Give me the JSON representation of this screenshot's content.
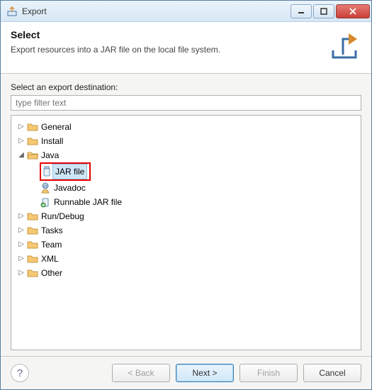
{
  "window": {
    "title": "Export"
  },
  "banner": {
    "title": "Select",
    "description": "Export resources into a JAR file on the local file system."
  },
  "content": {
    "label": "Select an export destination:",
    "filter_placeholder": "type filter text"
  },
  "tree": {
    "general": "General",
    "install": "Install",
    "java": "Java",
    "jar_file": "JAR file",
    "javadoc": "Javadoc",
    "runnable_jar": "Runnable JAR file",
    "run_debug": "Run/Debug",
    "tasks": "Tasks",
    "team": "Team",
    "xml": "XML",
    "other": "Other"
  },
  "buttons": {
    "back": "< Back",
    "next": "Next >",
    "finish": "Finish",
    "cancel": "Cancel"
  }
}
